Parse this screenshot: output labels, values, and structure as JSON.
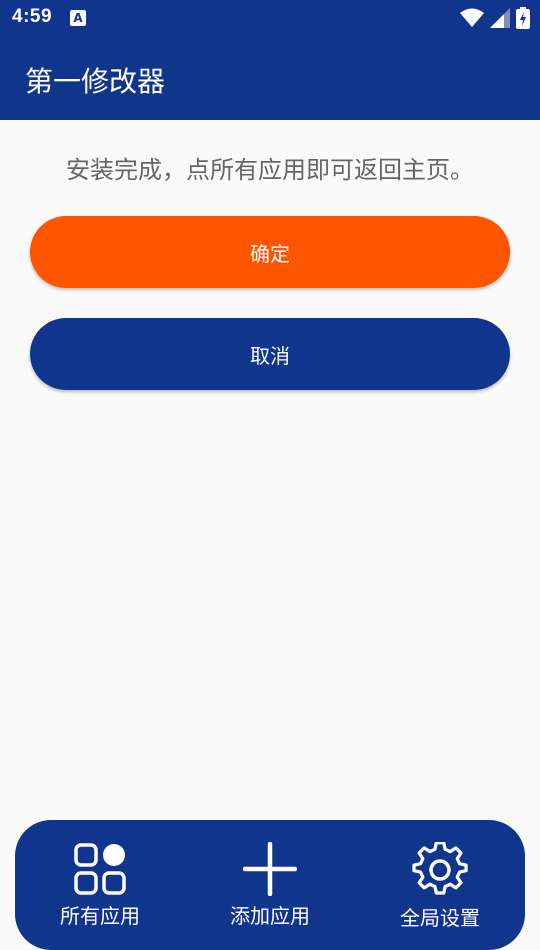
{
  "status": {
    "time": "4:59",
    "app_icon_letter": "A",
    "icons": [
      "wifi-icon",
      "signal-icon",
      "battery-icon"
    ]
  },
  "app_bar": {
    "title": "第一修改器"
  },
  "main": {
    "message": "安装完成，点所有应用即可返回主页。",
    "confirm_label": "确定",
    "cancel_label": "取消"
  },
  "bottom_nav": {
    "items": [
      {
        "label": "所有应用",
        "icon": "grid-apps-icon"
      },
      {
        "label": "添加应用",
        "icon": "plus-icon"
      },
      {
        "label": "全局设置",
        "icon": "gear-icon"
      }
    ]
  },
  "colors": {
    "primary": "#10358c",
    "accent": "#ff5500",
    "background": "#fafafa"
  }
}
